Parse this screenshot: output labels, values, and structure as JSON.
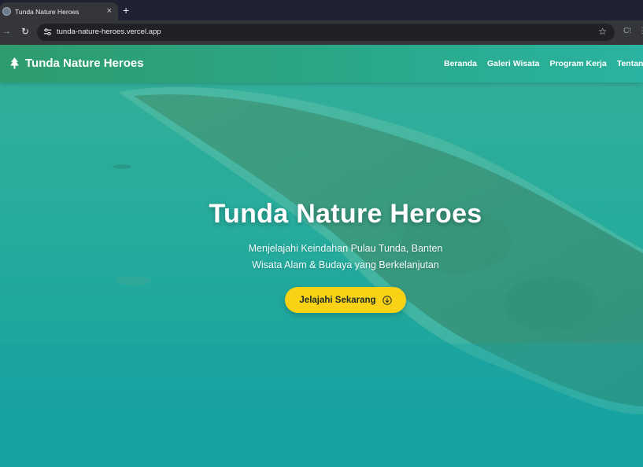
{
  "browser": {
    "tab_title": "Tunda Nature Heroes",
    "tab_close": "×",
    "new_tab": "+",
    "url": "tunda-nature-heroes.vercel.app",
    "star": "☆",
    "ext_label": "C!"
  },
  "site": {
    "brand": "Tunda Nature Heroes",
    "nav": [
      "Beranda",
      "Galeri Wisata",
      "Program Kerja",
      "Tentang"
    ]
  },
  "hero": {
    "title": "Tunda Nature Heroes",
    "subtitle_line1": "Menjelajahi Keindahan Pulau Tunda, Banten",
    "subtitle_line2": "Wisata Alam & Budaya yang Berkelanjutan",
    "cta_label": "Jelajahi Sekarang"
  },
  "colors": {
    "navbar_start": "#2e9c6e",
    "navbar_end": "#2ab3a0",
    "hero_teal": "#1a9c8f",
    "cta_yellow": "#f9d216",
    "chrome_dark": "#202124"
  }
}
